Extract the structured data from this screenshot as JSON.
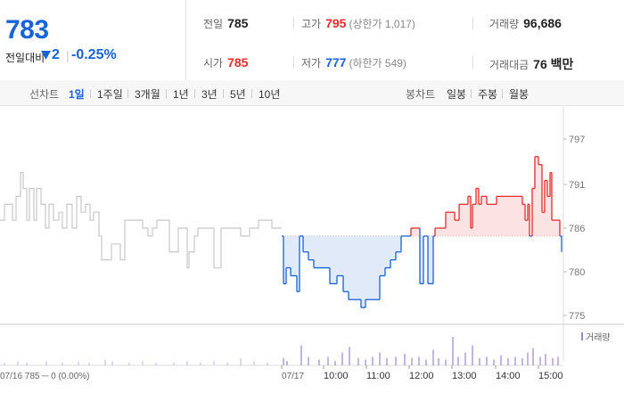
{
  "quote": {
    "price": "783",
    "change_label": "전일대비",
    "change_value": "2",
    "change_pct": "-0.25%",
    "direction": "down"
  },
  "summary": {
    "prev_close": {
      "label": "전일",
      "value": "785"
    },
    "open": {
      "label": "시가",
      "value": "785"
    },
    "high": {
      "label": "고가",
      "value": "795",
      "sub": "(상한가 1,017)"
    },
    "low": {
      "label": "저가",
      "value": "777",
      "sub": "(하한가 549)"
    },
    "volume": {
      "label": "거래량",
      "value": "96,686"
    },
    "amount": {
      "label": "거래대금",
      "value": "76 백만"
    }
  },
  "periods": {
    "line_label": "선차트",
    "line_items": [
      "1일",
      "1주일",
      "3개월",
      "1년",
      "3년",
      "5년",
      "10년"
    ],
    "line_selected": 0,
    "candle_label": "봉차트",
    "candle_items": [
      "일봉",
      "주봉",
      "월봉"
    ]
  },
  "colors": {
    "up": "#e52b2b",
    "down": "#1763d8",
    "up_fill": "#fbe0e0",
    "down_fill": "#dde8f7",
    "prev_day_line": "#c8c8c8",
    "volume_bar": "#9a87c8"
  },
  "chart_data": {
    "type": "line",
    "reference_price": 785,
    "ylim": [
      774,
      798
    ],
    "y_ticks": [
      "797",
      "791",
      "786",
      "780",
      "775"
    ],
    "volume_legend": "거래량",
    "x_labels": [
      "07/17",
      "10:00",
      "11:00",
      "12:00",
      "13:00",
      "14:00",
      "15:00"
    ],
    "prev_day_caption": "07/16  785 ─ 0 (0.00%)",
    "prev_day": [
      [
        0,
        787
      ],
      [
        5,
        787
      ],
      [
        5,
        789
      ],
      [
        14,
        789
      ],
      [
        14,
        787
      ],
      [
        18,
        787
      ],
      [
        18,
        790
      ],
      [
        23,
        790
      ],
      [
        23,
        793
      ],
      [
        26,
        793
      ],
      [
        26,
        791
      ],
      [
        30,
        791
      ],
      [
        30,
        787
      ],
      [
        33,
        787
      ],
      [
        33,
        791
      ],
      [
        38,
        791
      ],
      [
        38,
        787
      ],
      [
        41,
        787
      ],
      [
        41,
        791
      ],
      [
        46,
        791
      ],
      [
        46,
        789
      ],
      [
        51,
        789
      ],
      [
        51,
        786
      ],
      [
        55,
        786
      ],
      [
        55,
        789
      ],
      [
        60,
        789
      ],
      [
        60,
        787
      ],
      [
        66,
        787
      ],
      [
        66,
        788
      ],
      [
        70,
        788
      ],
      [
        70,
        786
      ],
      [
        75,
        786
      ],
      [
        75,
        789
      ],
      [
        81,
        789
      ],
      [
        81,
        786
      ],
      [
        86,
        786
      ],
      [
        86,
        790
      ],
      [
        91,
        790
      ],
      [
        91,
        788
      ],
      [
        96,
        788
      ],
      [
        96,
        789
      ],
      [
        101,
        789
      ],
      [
        101,
        787
      ],
      [
        105,
        787
      ],
      [
        105,
        788
      ],
      [
        111,
        788
      ],
      [
        111,
        785
      ],
      [
        114,
        785
      ],
      [
        114,
        782
      ],
      [
        125,
        782
      ],
      [
        125,
        784
      ],
      [
        135,
        784
      ],
      [
        135,
        782
      ],
      [
        140,
        782
      ],
      [
        140,
        787
      ],
      [
        160,
        787
      ],
      [
        160,
        786
      ],
      [
        166,
        786
      ],
      [
        166,
        785
      ],
      [
        171,
        785
      ],
      [
        171,
        786
      ],
      [
        176,
        786
      ],
      [
        176,
        787
      ],
      [
        190,
        787
      ],
      [
        190,
        783
      ],
      [
        200,
        783
      ],
      [
        200,
        786
      ],
      [
        210,
        786
      ],
      [
        210,
        781
      ],
      [
        212,
        781
      ],
      [
        212,
        783
      ],
      [
        218,
        783
      ],
      [
        218,
        785
      ],
      [
        222,
        785
      ],
      [
        222,
        786
      ],
      [
        240,
        786
      ],
      [
        240,
        781
      ],
      [
        248,
        781
      ],
      [
        248,
        786
      ],
      [
        270,
        786
      ],
      [
        270,
        785
      ],
      [
        280,
        785
      ],
      [
        280,
        786
      ],
      [
        290,
        786
      ],
      [
        290,
        787
      ],
      [
        305,
        787
      ],
      [
        305,
        786
      ],
      [
        316,
        786
      ]
    ],
    "today": [
      [
        316,
        785
      ],
      [
        318,
        785
      ],
      [
        318,
        779
      ],
      [
        321,
        779
      ],
      [
        321,
        781
      ],
      [
        326,
        781
      ],
      [
        326,
        780
      ],
      [
        333,
        780
      ],
      [
        333,
        778
      ],
      [
        336,
        778
      ],
      [
        336,
        785
      ],
      [
        340,
        785
      ],
      [
        340,
        783
      ],
      [
        346,
        783
      ],
      [
        346,
        782
      ],
      [
        352,
        782
      ],
      [
        352,
        781
      ],
      [
        370,
        781
      ],
      [
        370,
        779
      ],
      [
        378,
        779
      ],
      [
        378,
        780
      ],
      [
        385,
        780
      ],
      [
        385,
        778
      ],
      [
        391,
        778
      ],
      [
        391,
        777
      ],
      [
        405,
        777
      ],
      [
        405,
        776
      ],
      [
        410,
        776
      ],
      [
        410,
        777
      ],
      [
        413,
        777
      ],
      [
        413,
        777
      ],
      [
        426,
        777
      ],
      [
        426,
        780
      ],
      [
        432,
        780
      ],
      [
        432,
        781
      ],
      [
        438,
        781
      ],
      [
        438,
        782
      ],
      [
        444,
        782
      ],
      [
        444,
        783
      ],
      [
        450,
        783
      ],
      [
        450,
        785
      ],
      [
        455,
        785
      ],
      [
        455,
        785
      ],
      [
        461,
        785
      ],
      [
        461,
        786
      ],
      [
        471,
        786
      ],
      [
        471,
        779
      ],
      [
        475,
        779
      ],
      [
        475,
        785
      ],
      [
        480,
        785
      ],
      [
        480,
        779
      ],
      [
        486,
        779
      ],
      [
        486,
        785
      ],
      [
        488,
        785
      ],
      [
        488,
        786
      ],
      [
        500,
        786
      ],
      [
        500,
        788
      ],
      [
        510,
        788
      ],
      [
        510,
        787
      ],
      [
        515,
        787
      ],
      [
        515,
        789
      ],
      [
        525,
        789
      ],
      [
        525,
        790
      ],
      [
        528,
        790
      ],
      [
        528,
        786
      ],
      [
        530,
        786
      ],
      [
        530,
        789
      ],
      [
        534,
        789
      ],
      [
        534,
        791
      ],
      [
        537,
        791
      ],
      [
        537,
        789
      ],
      [
        540,
        789
      ],
      [
        540,
        790
      ],
      [
        546,
        790
      ],
      [
        546,
        789
      ],
      [
        551,
        789
      ],
      [
        551,
        789
      ],
      [
        557,
        789
      ],
      [
        557,
        790
      ],
      [
        563,
        790
      ],
      [
        563,
        790
      ],
      [
        586,
        790
      ],
      [
        586,
        789
      ],
      [
        589,
        789
      ],
      [
        589,
        787
      ],
      [
        592,
        787
      ],
      [
        592,
        789
      ],
      [
        594,
        789
      ],
      [
        594,
        785
      ],
      [
        597,
        785
      ],
      [
        597,
        791
      ],
      [
        600,
        791
      ],
      [
        600,
        795
      ],
      [
        604,
        795
      ],
      [
        604,
        794
      ],
      [
        608,
        794
      ],
      [
        608,
        788
      ],
      [
        611,
        788
      ],
      [
        611,
        792
      ],
      [
        614,
        792
      ],
      [
        614,
        790
      ],
      [
        617,
        790
      ],
      [
        617,
        793
      ],
      [
        619,
        793
      ],
      [
        619,
        787
      ],
      [
        622,
        787
      ],
      [
        622,
        787
      ],
      [
        628,
        787
      ],
      [
        628,
        785
      ],
      [
        630,
        785
      ],
      [
        630,
        783
      ]
    ],
    "volume_bars": [
      [
        5,
        2
      ],
      [
        20,
        3
      ],
      [
        30,
        2
      ],
      [
        52,
        3
      ],
      [
        70,
        2
      ],
      [
        88,
        3
      ],
      [
        100,
        2
      ],
      [
        118,
        4
      ],
      [
        126,
        3
      ],
      [
        145,
        2
      ],
      [
        160,
        3
      ],
      [
        175,
        2
      ],
      [
        195,
        2
      ],
      [
        210,
        3
      ],
      [
        225,
        2
      ],
      [
        240,
        3
      ],
      [
        255,
        2
      ],
      [
        270,
        5
      ],
      [
        285,
        3
      ],
      [
        300,
        2
      ],
      [
        318,
        5
      ],
      [
        322,
        3
      ],
      [
        338,
        14
      ],
      [
        346,
        6
      ],
      [
        358,
        4
      ],
      [
        368,
        6
      ],
      [
        376,
        3
      ],
      [
        384,
        9
      ],
      [
        392,
        13
      ],
      [
        402,
        5
      ],
      [
        410,
        4
      ],
      [
        418,
        6
      ],
      [
        426,
        9
      ],
      [
        434,
        5
      ],
      [
        444,
        6
      ],
      [
        454,
        8
      ],
      [
        462,
        5
      ],
      [
        470,
        6
      ],
      [
        478,
        4
      ],
      [
        486,
        11
      ],
      [
        492,
        5
      ],
      [
        500,
        4
      ],
      [
        508,
        20
      ],
      [
        514,
        6
      ],
      [
        522,
        9
      ],
      [
        530,
        14
      ],
      [
        538,
        5
      ],
      [
        546,
        6
      ],
      [
        554,
        4
      ],
      [
        562,
        7
      ],
      [
        570,
        5
      ],
      [
        578,
        6
      ],
      [
        586,
        5
      ],
      [
        592,
        9
      ],
      [
        598,
        12
      ],
      [
        606,
        6
      ],
      [
        612,
        8
      ],
      [
        620,
        5
      ],
      [
        626,
        6
      ]
    ]
  }
}
